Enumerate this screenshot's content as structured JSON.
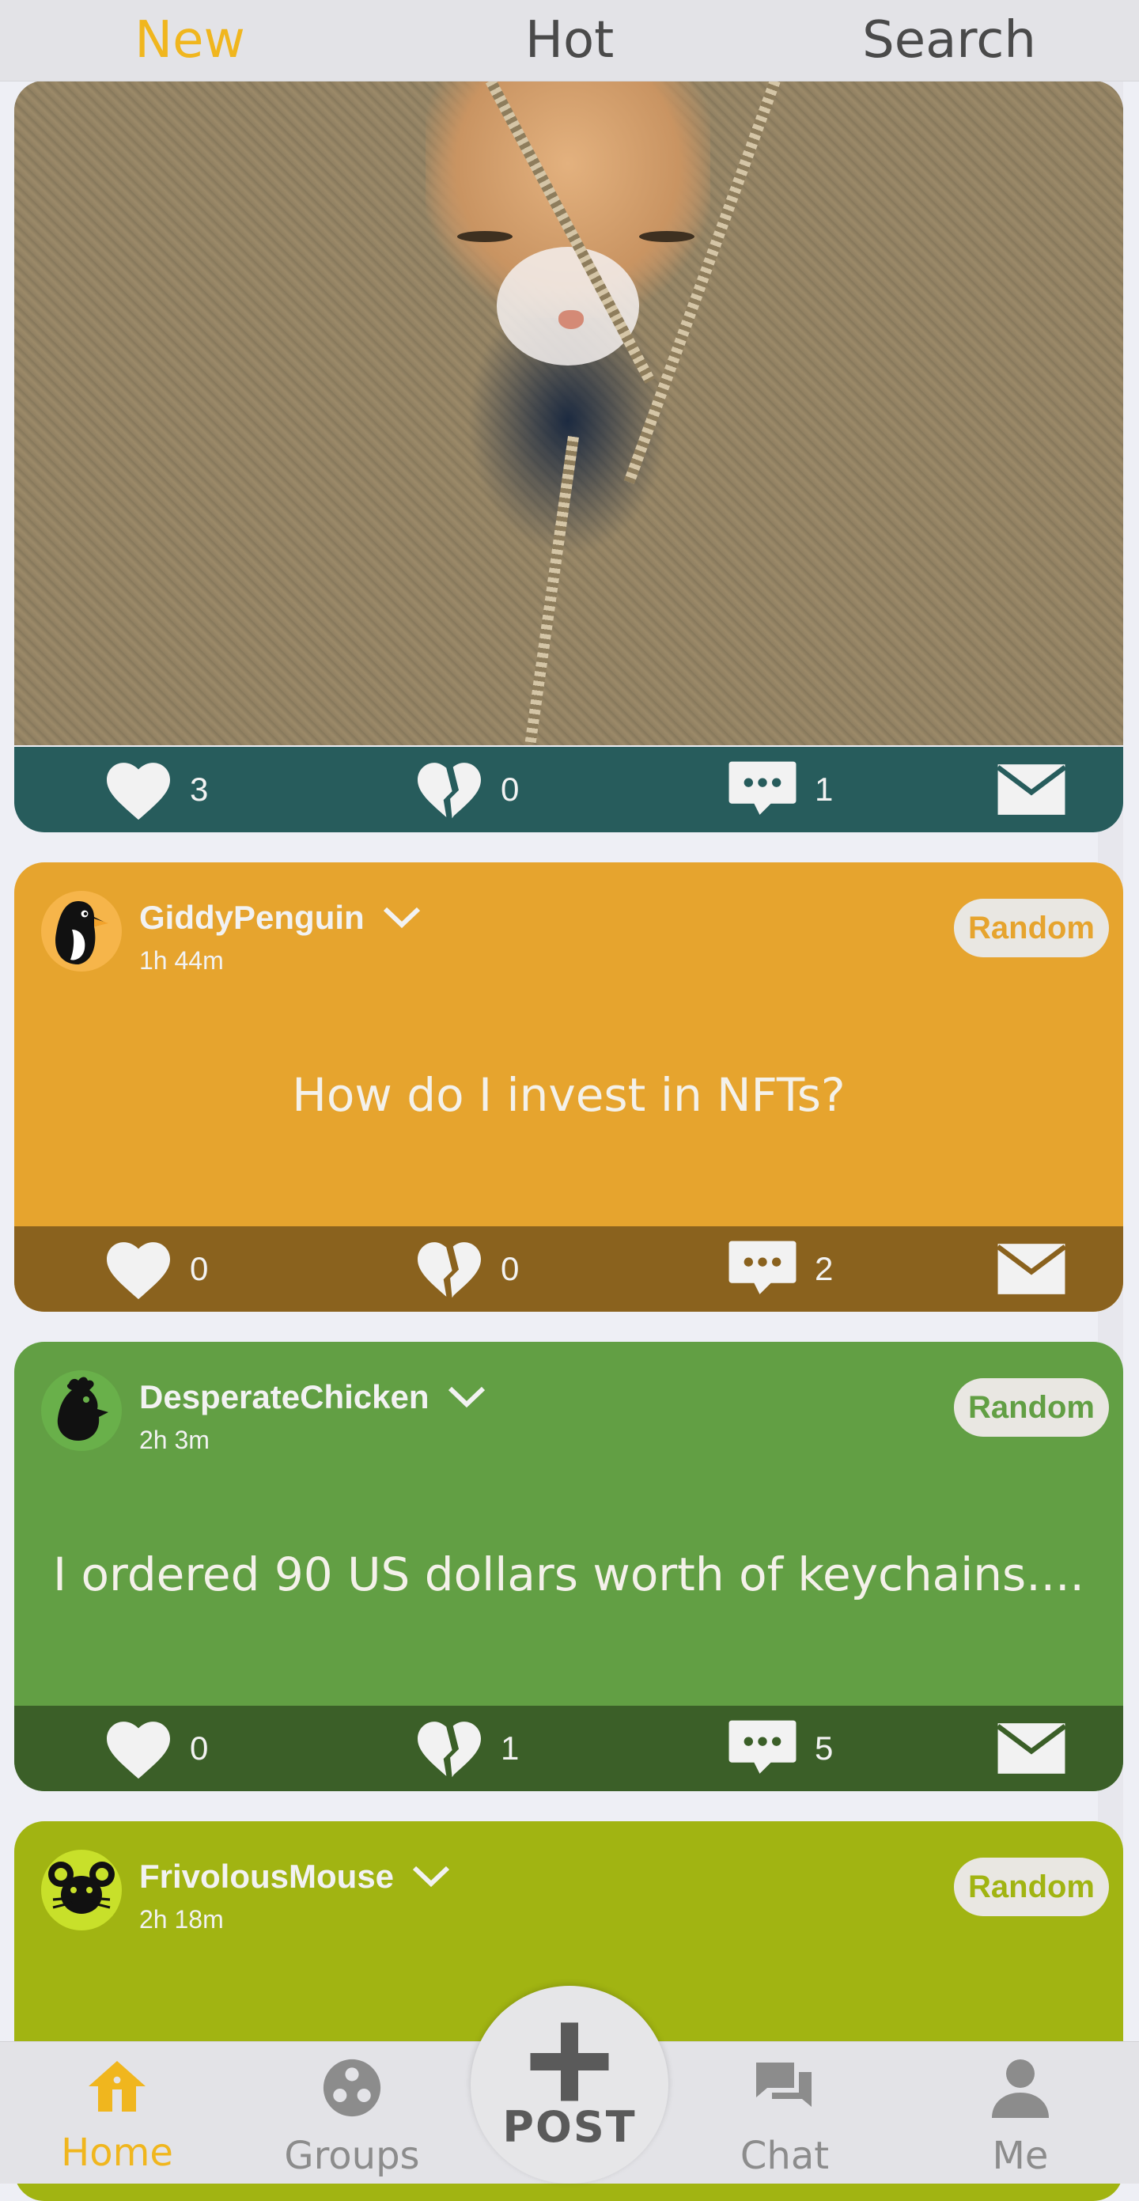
{
  "top_tabs": [
    {
      "label": "New",
      "active": true
    },
    {
      "label": "Hot",
      "active": false
    },
    {
      "label": "Search",
      "active": false
    }
  ],
  "posts": [
    {
      "type": "image",
      "image_desc": "cat in fleece jacket",
      "bar_color": "#275c5c",
      "likes": "3",
      "dislikes": "0",
      "comments": "1"
    },
    {
      "username": "GiddyPenguin",
      "time": "1h 44m",
      "badge": "Random",
      "text": "How do I invest in NFTs?",
      "card_color": "#e6a42e",
      "bar_color": "#8a621e",
      "avatar_bg": "#f6b54a",
      "avatar_icon": "penguin-icon",
      "likes": "0",
      "dislikes": "0",
      "comments": "2"
    },
    {
      "username": "DesperateChicken",
      "time": "2h 3m",
      "badge": "Random",
      "text": "I ordered 90 US dollars worth of keychains....",
      "card_color": "#629f44",
      "bar_color": "#3b5f28",
      "avatar_bg": "#69b04a",
      "avatar_icon": "chicken-icon",
      "likes": "0",
      "dislikes": "1",
      "comments": "5"
    },
    {
      "username": "FrivolousMouse",
      "time": "2h 18m",
      "badge": "Random",
      "card_color": "#a1b412",
      "avatar_bg": "#c8e02a",
      "avatar_icon": "mouse-icon"
    }
  ],
  "bottom_nav": [
    {
      "label": "Home",
      "icon": "home-icon",
      "active": true
    },
    {
      "label": "Groups",
      "icon": "groups-icon",
      "active": false
    },
    {
      "label": "Chat",
      "icon": "chat-icon",
      "active": false
    },
    {
      "label": "Me",
      "icon": "person-icon",
      "active": false
    }
  ],
  "post_button": {
    "label": "POST",
    "icon": "plus-icon"
  },
  "colors": {
    "accent": "#f0b61e",
    "nav_inactive": "#8c8c8c"
  }
}
